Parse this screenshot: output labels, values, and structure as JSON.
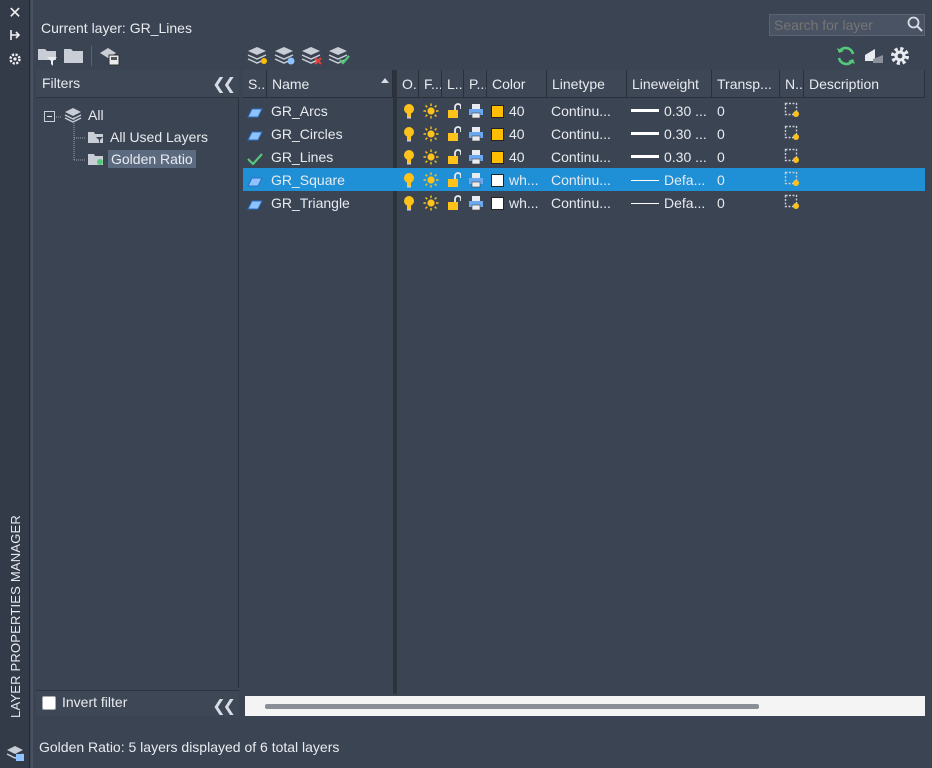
{
  "panel_title": "LAYER PROPERTIES MANAGER",
  "current_layer": "Current layer: GR_Lines",
  "search": {
    "placeholder": "Search for layer"
  },
  "filters": {
    "header": "Filters",
    "tree": [
      {
        "label": "All"
      },
      {
        "label": "All Used Layers"
      },
      {
        "label": "Golden Ratio",
        "selected": true
      }
    ],
    "invert_filter_label": "Invert filter",
    "invert_filter_checked": false
  },
  "columns": [
    "S...",
    "Name",
    "O...",
    "F...",
    "L...",
    "P...",
    "Color",
    "Linetype",
    "Lineweight",
    "Transp...",
    "N...",
    "Description"
  ],
  "layers": [
    {
      "name": "GR_Arcs",
      "status": "layer",
      "color_label": "40",
      "color_hex": "#ffbf00",
      "linetype": "Continu...",
      "lineweight": "0.30 ...",
      "transparency": "0",
      "selected": false
    },
    {
      "name": "GR_Circles",
      "status": "layer",
      "color_label": "40",
      "color_hex": "#ffbf00",
      "linetype": "Continu...",
      "lineweight": "0.30 ...",
      "transparency": "0",
      "selected": false
    },
    {
      "name": "GR_Lines",
      "status": "current",
      "color_label": "40",
      "color_hex": "#ffbf00",
      "linetype": "Continu...",
      "lineweight": "0.30 ...",
      "transparency": "0",
      "selected": false
    },
    {
      "name": "GR_Square",
      "status": "layer",
      "color_label": "wh...",
      "color_hex": "#ffffff",
      "linetype": "Continu...",
      "lineweight": "Defa...",
      "transparency": "0",
      "selected": true
    },
    {
      "name": "GR_Triangle",
      "status": "layer",
      "color_label": "wh...",
      "color_hex": "#ffffff",
      "linetype": "Continu...",
      "lineweight": "Defa...",
      "transparency": "0",
      "selected": false
    }
  ],
  "status_bar": "Golden Ratio: 5 layers displayed of 6 total layers",
  "colors": {
    "selection": "#1f8fd6",
    "background": "#3b4453"
  }
}
